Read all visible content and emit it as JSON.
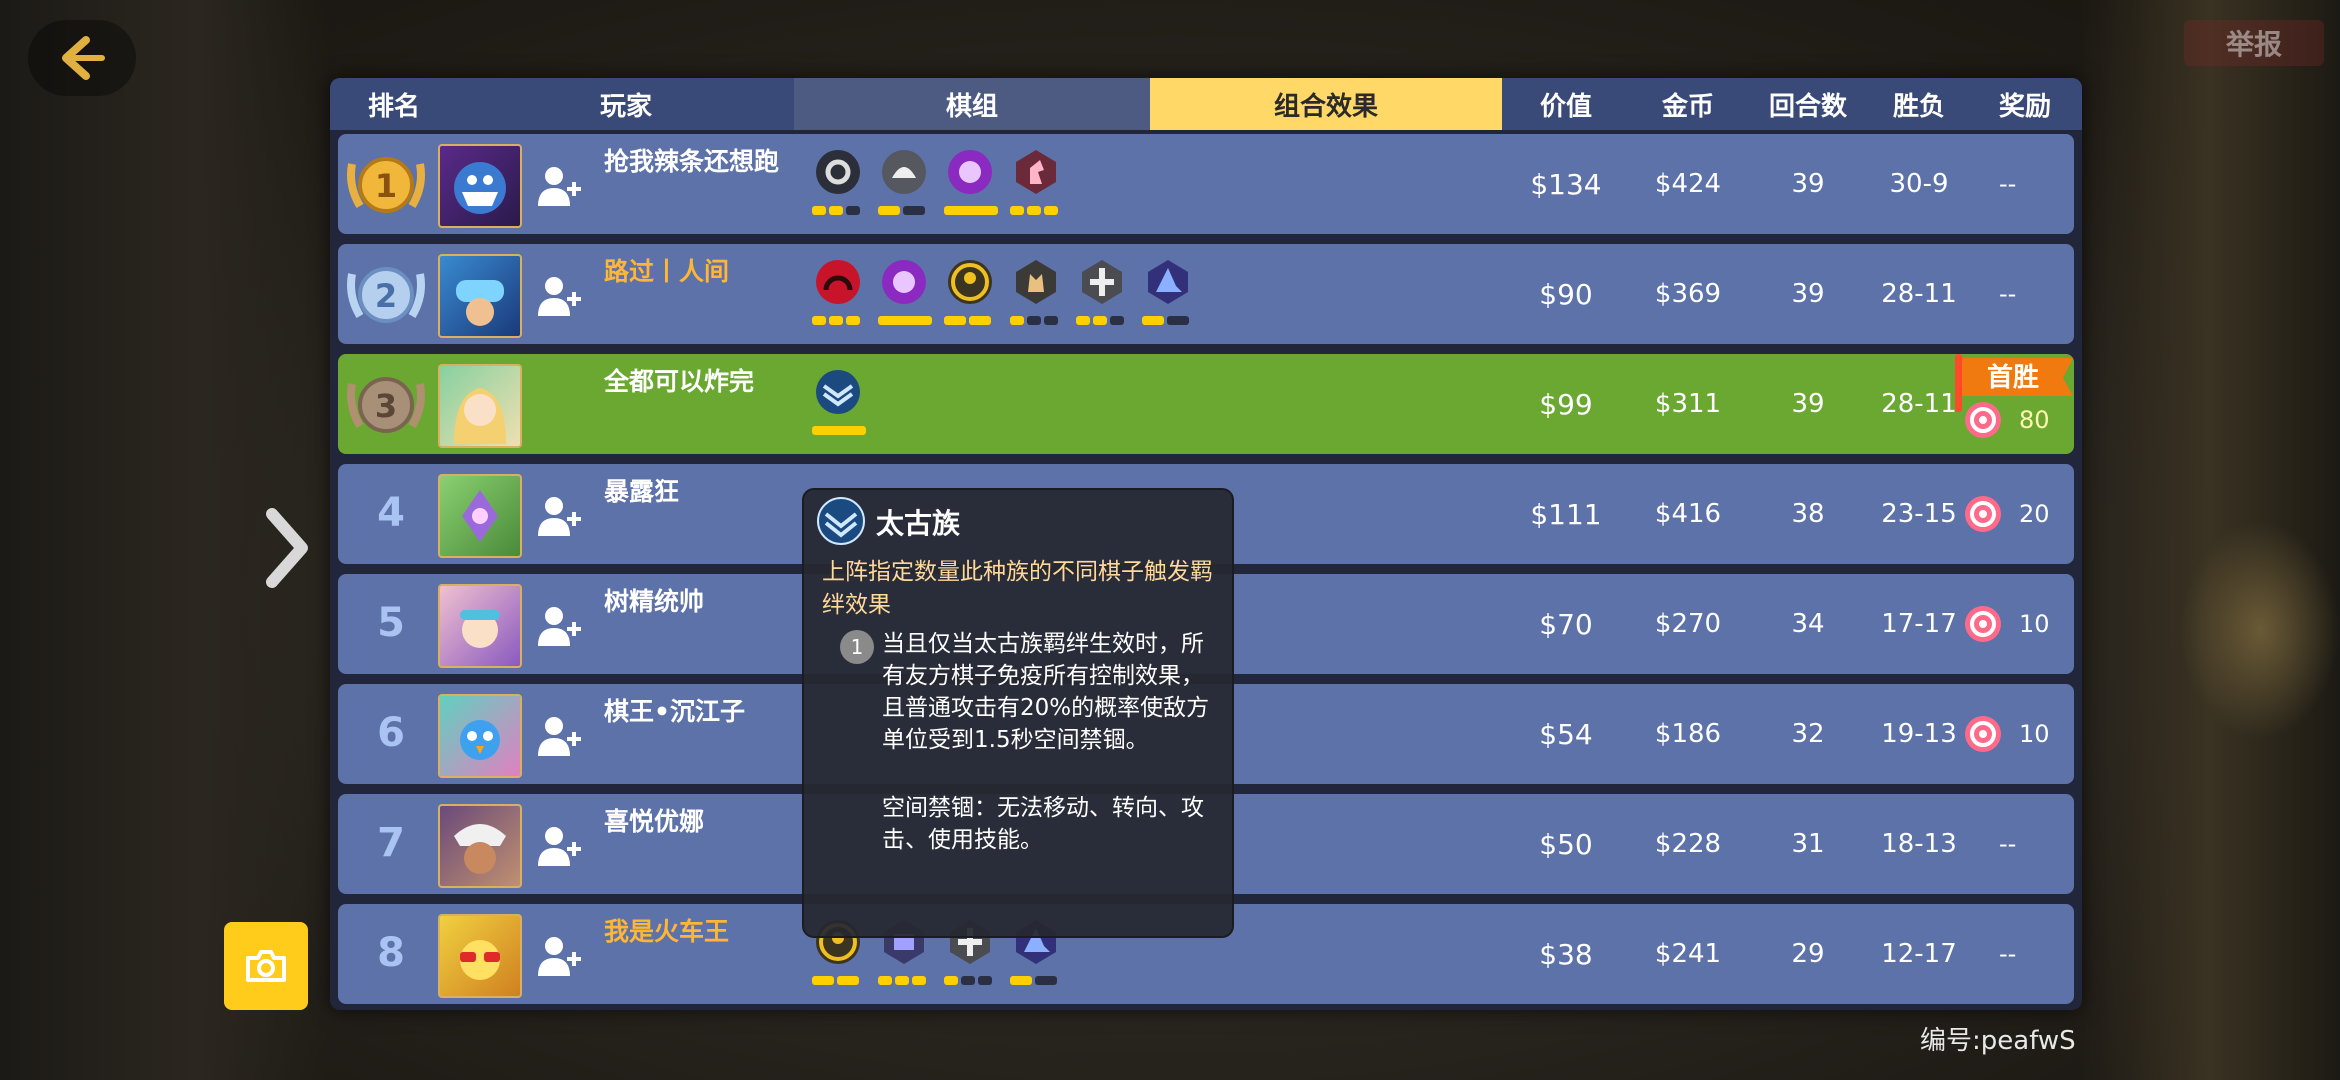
{
  "header": {
    "report_label": "举报",
    "columns": {
      "rank": "排名",
      "player": "玩家",
      "modules": "棋组",
      "combo": "组合效果",
      "value": "价值",
      "gold": "金币",
      "rounds": "回合数",
      "record": "胜负",
      "reward": "奖励"
    }
  },
  "rows": [
    {
      "rank": "1",
      "name": "抢我辣条还想跑",
      "value": "$134",
      "gold": "$424",
      "rounds": "39",
      "record": "30-9",
      "reward": "--",
      "reward_amount": ""
    },
    {
      "rank": "2",
      "name": "路过丨人间",
      "value": "$90",
      "gold": "$369",
      "rounds": "39",
      "record": "28-11",
      "reward": "--",
      "reward_amount": ""
    },
    {
      "rank": "3",
      "name": "全都可以炸完",
      "value": "$99",
      "gold": "$311",
      "rounds": "39",
      "record": "28-11",
      "reward": "首胜",
      "reward_amount": "80"
    },
    {
      "rank": "4",
      "name": "暴露狂",
      "value": "$111",
      "gold": "$416",
      "rounds": "38",
      "record": "23-15",
      "reward": "",
      "reward_amount": "20"
    },
    {
      "rank": "5",
      "name": "树精统帅",
      "value": "$70",
      "gold": "$270",
      "rounds": "34",
      "record": "17-17",
      "reward": "",
      "reward_amount": "10"
    },
    {
      "rank": "6",
      "name": "棋王•沉江子",
      "value": "$54",
      "gold": "$186",
      "rounds": "32",
      "record": "19-13",
      "reward": "",
      "reward_amount": "10"
    },
    {
      "rank": "7",
      "name": "喜悦优娜",
      "value": "$50",
      "gold": "$228",
      "rounds": "31",
      "record": "18-13",
      "reward": "--",
      "reward_amount": ""
    },
    {
      "rank": "8",
      "name": "我是火车王",
      "value": "$38",
      "gold": "$241",
      "rounds": "29",
      "record": "12-17",
      "reward": "--",
      "reward_amount": ""
    }
  ],
  "tooltip": {
    "title": "太古族",
    "description": "上阵指定数量此种族的不同棋子触发羁绊效果",
    "tier_number": "1",
    "effect": "当且仅当太古族羁绊生效时，所有友方棋子免疫所有控制效果，且普通攻击有20%的概率使敌方单位受到1.5秒空间禁锢。",
    "effect_note": "空间禁锢：无法移动、转向、攻击、使用技能。"
  },
  "footer": {
    "serial": "编号:peafwS"
  },
  "colors": {
    "row_bg": "#5c72a8",
    "highlight_row": "#6aa832",
    "combo_tab": "#ffd868",
    "active_bar": "#ffd000",
    "name_highlight": "#ffb536"
  }
}
